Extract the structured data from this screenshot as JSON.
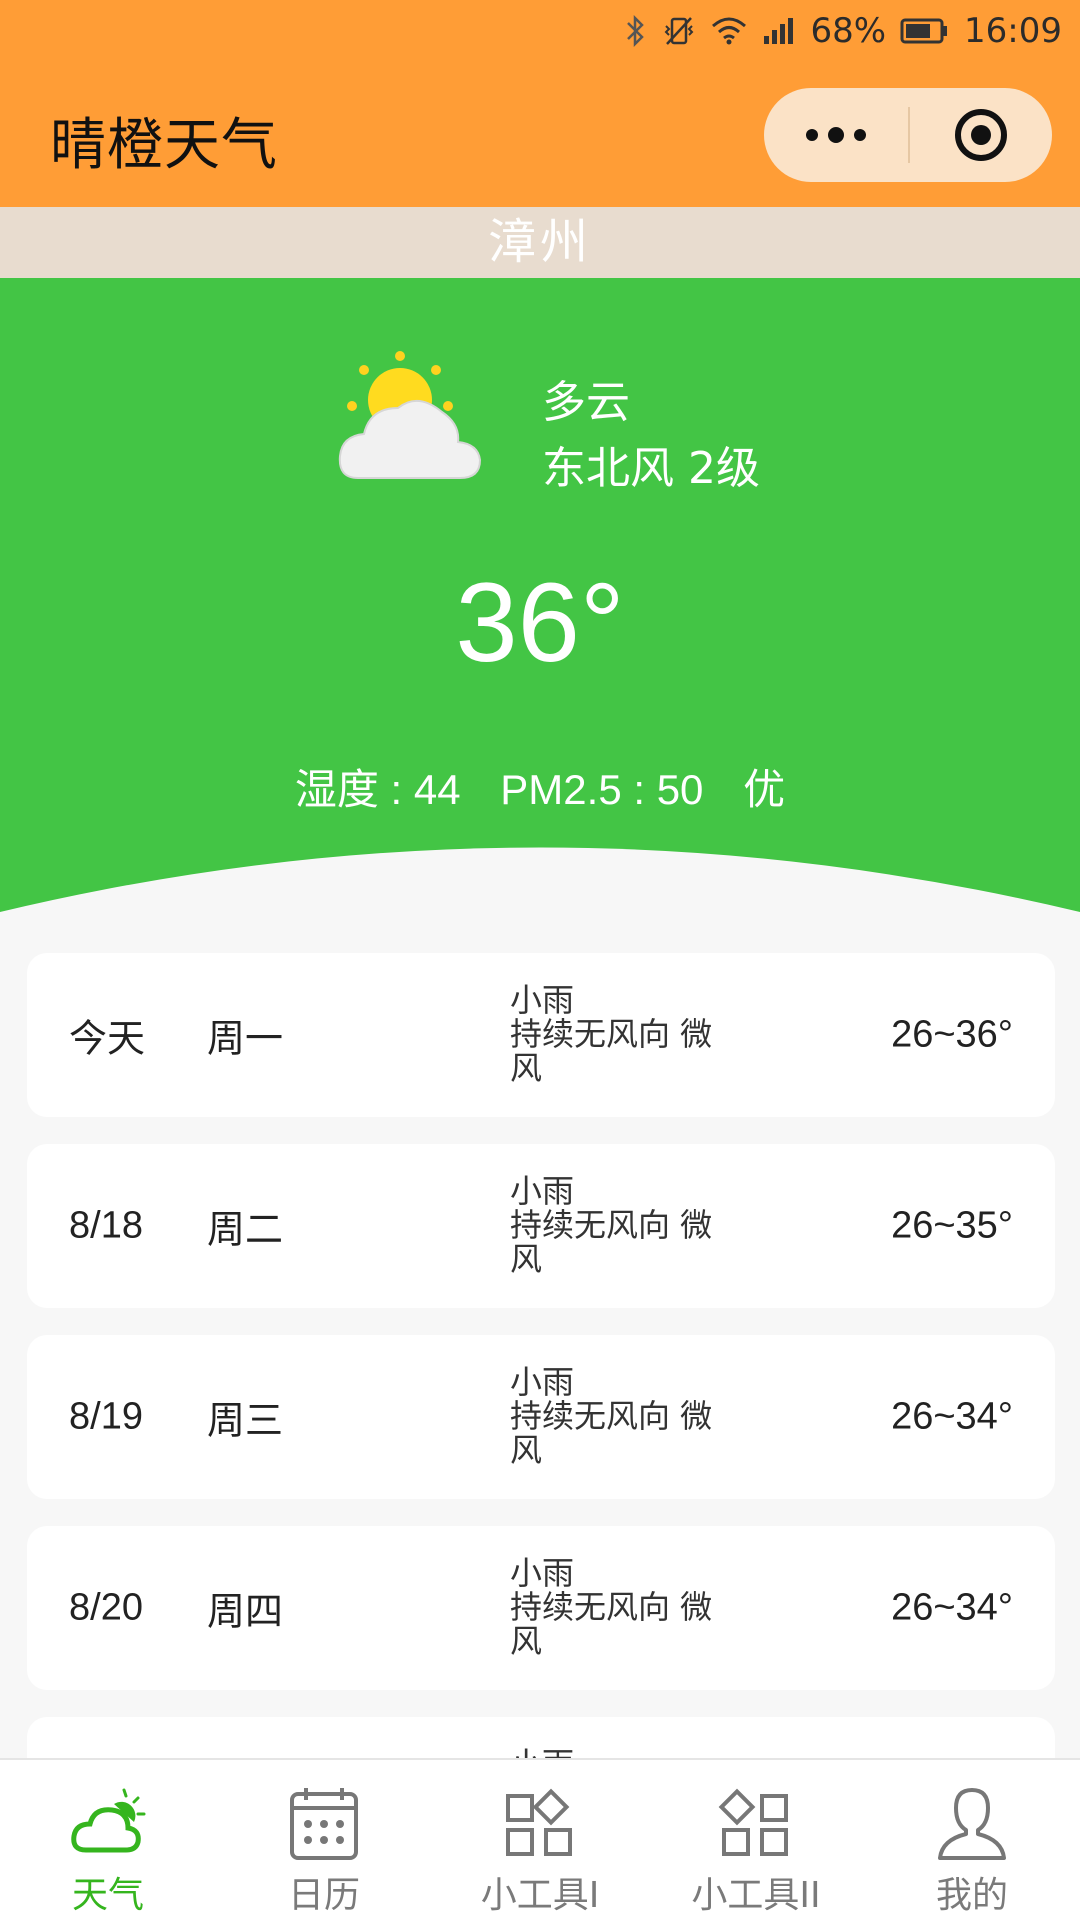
{
  "status_bar": {
    "battery": "68%",
    "time": "16:09"
  },
  "nav": {
    "title": "晴橙天气"
  },
  "city": "漳州",
  "current": {
    "condition": "多云",
    "wind": "东北风 2级",
    "temperature": "36°",
    "humidity_label": "湿度 : 44",
    "pm25_label": "PM2.5 : 50",
    "air_quality": "优",
    "icon": "partly-cloudy-icon"
  },
  "forecast": [
    {
      "date": "今天",
      "weekday": "周一",
      "condition": "小雨",
      "wind": "持续无风向 微风",
      "range": "26~36°"
    },
    {
      "date": "8/18",
      "weekday": "周二",
      "condition": "小雨",
      "wind": "持续无风向 微风",
      "range": "26~35°"
    },
    {
      "date": "8/19",
      "weekday": "周三",
      "condition": "小雨",
      "wind": "持续无风向 微风",
      "range": "26~34°"
    },
    {
      "date": "8/20",
      "weekday": "周四",
      "condition": "小雨",
      "wind": "持续无风向 微风",
      "range": "26~34°"
    },
    {
      "date": "",
      "weekday": "",
      "condition": "小雨",
      "wind": "",
      "range": ""
    }
  ],
  "tabs": [
    {
      "label": "天气",
      "icon": "weather-icon",
      "active": true
    },
    {
      "label": "日历",
      "icon": "calendar-icon",
      "active": false
    },
    {
      "label": "小工具I",
      "icon": "tools-icon",
      "active": false
    },
    {
      "label": "小工具II",
      "icon": "tools-icon",
      "active": false
    },
    {
      "label": "我的",
      "icon": "profile-icon",
      "active": false
    }
  ],
  "colors": {
    "header": "#ff9d36",
    "hero": "#43c545",
    "city_band": "#e8dccf",
    "active_tab": "#35b51e"
  }
}
